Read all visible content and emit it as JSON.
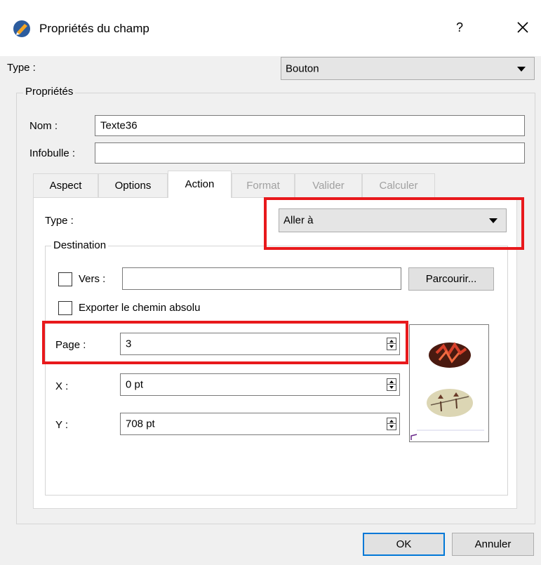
{
  "window": {
    "title": "Propriétés du champ",
    "help_glyph": "?",
    "close_glyph": "✕"
  },
  "field_type": {
    "label": "Type :",
    "value": "Bouton"
  },
  "properties": {
    "group_title": "Propriétés",
    "name_label": "Nom :",
    "name_value": "Texte36",
    "tooltip_label": "Infobulle :",
    "tooltip_value": ""
  },
  "tabs": [
    {
      "label": "Aspect",
      "state": "normal"
    },
    {
      "label": "Options",
      "state": "normal"
    },
    {
      "label": "Action",
      "state": "active"
    },
    {
      "label": "Format",
      "state": "disabled"
    },
    {
      "label": "Valider",
      "state": "disabled"
    },
    {
      "label": "Calculer",
      "state": "disabled"
    }
  ],
  "action": {
    "type_label": "Type :",
    "type_value": "Aller à",
    "destination_title": "Destination",
    "to_label": "Vers :",
    "to_value": "",
    "browse_label": "Parcourir...",
    "export_abs_label": "Exporter le chemin absolu",
    "page_label": "Page :",
    "page_value": "3",
    "x_label": "X :",
    "x_value": "0 pt",
    "y_label": "Y :",
    "y_value": "708 pt"
  },
  "buttons": {
    "ok": "OK",
    "cancel": "Annuler"
  },
  "colors": {
    "highlight": "#e8191c",
    "accent": "#0078d7"
  }
}
